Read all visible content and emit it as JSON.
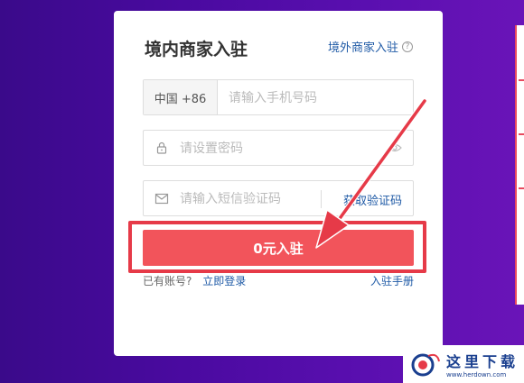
{
  "colors": {
    "accent": "#f2545b",
    "highlight_frame": "#e63a48",
    "link": "#1f5aa6",
    "background_gradient": [
      "#3a0a8a",
      "#6a14b8"
    ]
  },
  "form": {
    "title": "境内商家入驻",
    "abroad_link": "境外商家入驻",
    "help_icon": "?",
    "phone": {
      "country_code": "中国 +86",
      "placeholder": "请输入手机号码"
    },
    "password": {
      "placeholder": "请设置密码",
      "icon": "lock-icon",
      "toggle_icon": "eye-icon"
    },
    "sms": {
      "placeholder": "请输入短信验证码",
      "icon": "mail-icon",
      "get_code_label": "获取验证码"
    },
    "submit_label": "0元入驻",
    "footer": {
      "has_account": "已有账号?",
      "login": "立即登录",
      "manual": "入驻手册"
    }
  },
  "watermark": {
    "cn": "这里下载",
    "url": "www.herdown.com"
  }
}
